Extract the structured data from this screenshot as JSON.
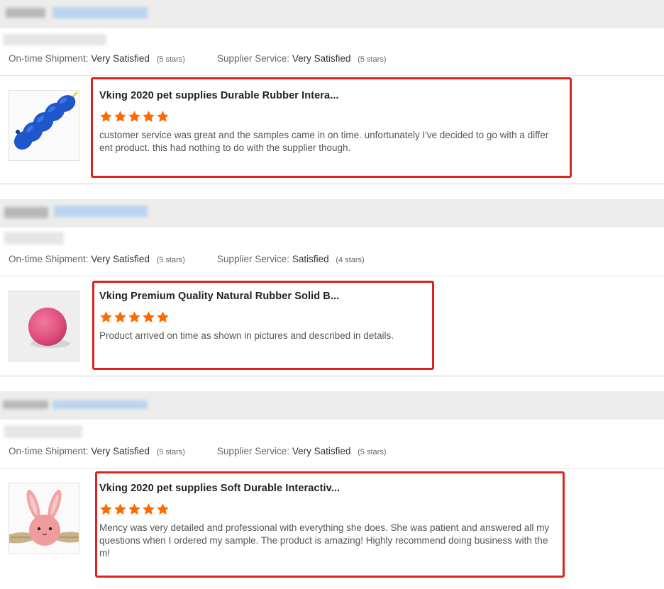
{
  "labels": {
    "shipment": "On-time Shipment:",
    "service": "Supplier Service:"
  },
  "reviews": [
    {
      "shipment_value": "Very Satisfied",
      "shipment_stars": "(5 stars)",
      "service_value": "Very Satisfied",
      "service_stars": "(5 stars)",
      "product_title": "Vking 2020 pet supplies Durable Rubber Intera...",
      "rating": 5,
      "comment_lines": [
        "customer service was great and the samples came in on time. unfortunately I've decided to go with a differ",
        "ent product. this had nothing to do with the supplier though."
      ],
      "image": "blue-rubber-chew-toy"
    },
    {
      "shipment_value": "Very Satisfied",
      "shipment_stars": "(5 stars)",
      "service_value": "Satisfied",
      "service_stars": "(4 stars)",
      "product_title": "Vking Premium Quality Natural Rubber Solid B...",
      "rating": 5,
      "comment_lines": [
        "Product arrived on time as shown in pictures and described in details."
      ],
      "image": "pink-rubber-ball"
    },
    {
      "shipment_value": "Very Satisfied",
      "shipment_stars": "(5 stars)",
      "service_value": "Very Satisfied",
      "service_stars": "(5 stars)",
      "product_title": "Vking 2020 pet supplies Soft Durable Interactiv...",
      "rating": 5,
      "comment_lines": [
        "Mency was very detailed and professional with everything she does. She was patient and answered all my",
        "questions when I ordered my sample. The product is amazing! Highly recommend doing business with the",
        "m!"
      ],
      "image": "pink-bunny-plush-toy"
    }
  ],
  "colors": {
    "star": "#ff6a00",
    "highlight": "#d9251d",
    "header_bg": "#ececec"
  }
}
